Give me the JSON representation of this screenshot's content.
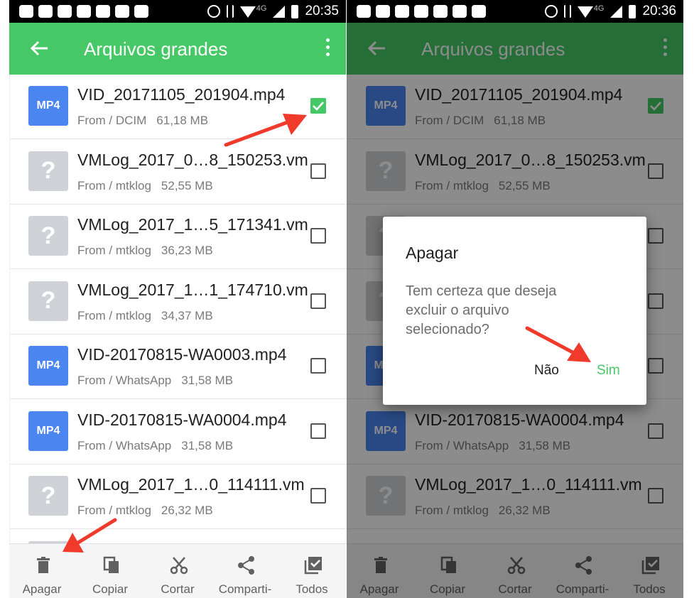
{
  "screens": {
    "left": {
      "clock": "20:35"
    },
    "right": {
      "clock": "20:36"
    }
  },
  "status": {
    "network": "4G"
  },
  "appbar": {
    "title": "Arquivos grandes"
  },
  "files": [
    {
      "name": "VID_20171105_201904.mp4",
      "type": "MP4",
      "from": "From / DCIM",
      "size": "61,18 MB",
      "checked": true
    },
    {
      "name": "VMLog_2017_0…8_150253.vm",
      "type": "?",
      "from": "From / mtklog",
      "size": "52,55 MB",
      "checked": false
    },
    {
      "name": "VMLog_2017_1…5_171341.vm",
      "type": "?",
      "from": "From / mtklog",
      "size": "36,23 MB",
      "checked": false
    },
    {
      "name": "VMLog_2017_1…1_174710.vm",
      "type": "?",
      "from": "From / mtklog",
      "size": "34,37 MB",
      "checked": false
    },
    {
      "name": "VID-20170815-WA0003.mp4",
      "type": "MP4",
      "from": "From / WhatsApp",
      "size": "31,58 MB",
      "checked": false
    },
    {
      "name": "VID-20170815-WA0004.mp4",
      "type": "MP4",
      "from": "From / WhatsApp",
      "size": "31,58 MB",
      "checked": false
    },
    {
      "name": "VMLog_2017_1…0_114111.vm",
      "type": "?",
      "from": "From / mtklog",
      "size": "26,32 MB",
      "checked": false
    }
  ],
  "bottombar": {
    "delete_label": "Apagar",
    "copy_label": "Copiar",
    "cut_label": "Cortar",
    "share_label": "Comparti-",
    "all_label": "Todos"
  },
  "dialog": {
    "title": "Apagar",
    "message": "Tem certeza que deseja excluir o arquivo selecionado?",
    "cancel_label": "Não",
    "confirm_label": "Sim"
  },
  "colors": {
    "accent": "#45c865",
    "mp4_thumb": "#4a85f0",
    "unknown_thumb": "#cfd2d6",
    "annotation_arrow": "#f03a2c"
  }
}
